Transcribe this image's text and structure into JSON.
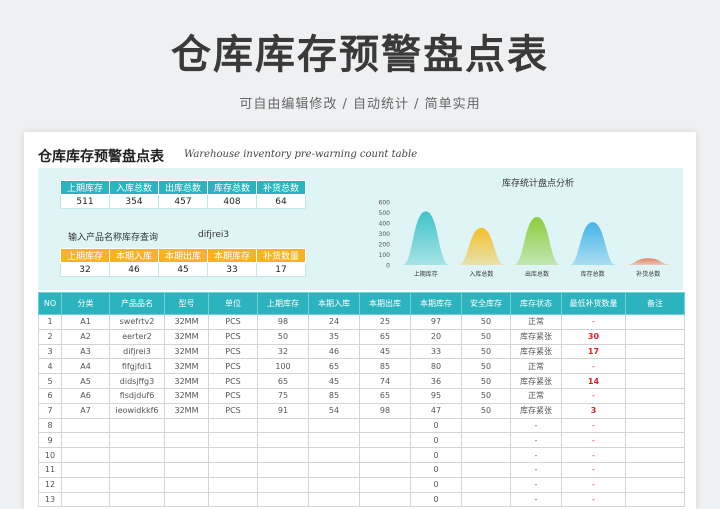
{
  "hero": {
    "title": "仓库库存预警盘点表",
    "subtitle": "可自由编辑修改 / 自动统计 / 简单实用"
  },
  "sheet": {
    "title": "仓库库存预警盘点表",
    "subtitle": "Warehouse inventory pre-warning count table"
  },
  "summary": {
    "headers": [
      "上期库存",
      "入库总数",
      "出库总数",
      "库存总数",
      "补货总数"
    ],
    "values": [
      "511",
      "354",
      "457",
      "408",
      "64"
    ]
  },
  "query": {
    "label": "输入产品名称库存查询",
    "value": "difjrei3",
    "headers": [
      "上期库存",
      "本期入库",
      "本期出库",
      "本期库存",
      "补货数量"
    ],
    "values": [
      "32",
      "46",
      "45",
      "33",
      "17"
    ]
  },
  "chart_data": {
    "type": "area",
    "title": "库存统计盘点分析",
    "categories": [
      "上期库存",
      "入库总数",
      "出库总数",
      "库存总数",
      "补货总数"
    ],
    "values": [
      511,
      354,
      457,
      408,
      64
    ],
    "ylim": [
      0,
      600
    ],
    "yticks": [
      "600",
      "500",
      "400",
      "300",
      "200",
      "100",
      "0"
    ],
    "colors": [
      "#3fc3c9",
      "#f5c02a",
      "#8ccc3c",
      "#46b4e8",
      "#e9805a"
    ]
  },
  "table": {
    "headers": [
      "NO",
      "分类",
      "产品品名",
      "型号",
      "单位",
      "上期库存",
      "本期入库",
      "本期出库",
      "本期库存",
      "安全库存",
      "库存状态",
      "最低补货数量",
      "备注"
    ],
    "rows": [
      [
        "1",
        "A1",
        "swefrtv2",
        "32MM",
        "PCS",
        "98",
        "24",
        "25",
        "97",
        "50",
        "正常",
        "-",
        ""
      ],
      [
        "2",
        "A2",
        "eerter2",
        "32MM",
        "PCS",
        "50",
        "35",
        "65",
        "20",
        "50",
        "库存紧张",
        "30",
        ""
      ],
      [
        "3",
        "A3",
        "difjrei3",
        "32MM",
        "PCS",
        "32",
        "46",
        "45",
        "33",
        "50",
        "库存紧张",
        "17",
        ""
      ],
      [
        "4",
        "A4",
        "fifgjfdi1",
        "32MM",
        "PCS",
        "100",
        "65",
        "85",
        "80",
        "50",
        "正常",
        "-",
        ""
      ],
      [
        "5",
        "A5",
        "didsjffg3",
        "32MM",
        "PCS",
        "65",
        "45",
        "74",
        "36",
        "50",
        "库存紧张",
        "14",
        ""
      ],
      [
        "6",
        "A6",
        "fisdjduf6",
        "32MM",
        "PCS",
        "75",
        "85",
        "65",
        "95",
        "50",
        "正常",
        "-",
        ""
      ],
      [
        "7",
        "A7",
        "ieowidkkf6",
        "32MM",
        "PCS",
        "91",
        "54",
        "98",
        "47",
        "50",
        "库存紧张",
        "3",
        ""
      ],
      [
        "8",
        "",
        "",
        "",
        "",
        "",
        "",
        "",
        "0",
        "",
        "-",
        "-",
        ""
      ],
      [
        "9",
        "",
        "",
        "",
        "",
        "",
        "",
        "",
        "0",
        "",
        "-",
        "-",
        ""
      ],
      [
        "10",
        "",
        "",
        "",
        "",
        "",
        "",
        "",
        "0",
        "",
        "-",
        "-",
        ""
      ],
      [
        "11",
        "",
        "",
        "",
        "",
        "",
        "",
        "",
        "0",
        "",
        "-",
        "-",
        ""
      ],
      [
        "12",
        "",
        "",
        "",
        "",
        "",
        "",
        "",
        "0",
        "",
        "-",
        "-",
        ""
      ],
      [
        "13",
        "",
        "",
        "",
        "",
        "",
        "",
        "",
        "0",
        "",
        "-",
        "-",
        ""
      ]
    ]
  }
}
